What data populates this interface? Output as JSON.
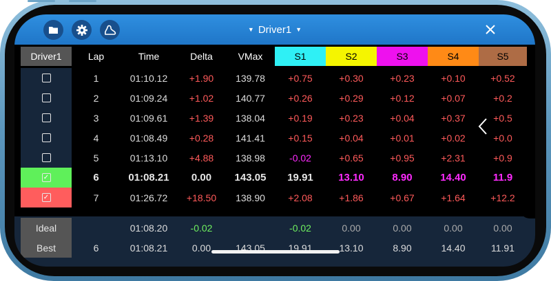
{
  "topbar": {
    "title": "Driver1",
    "left_icons": [
      "folder-icon",
      "gear-icon",
      "track-map-icon"
    ],
    "close_icon": "close-icon",
    "color": "#2a86d8"
  },
  "columns": [
    "Driver1",
    "Lap",
    "Time",
    "Delta",
    "VMax",
    "S1",
    "S2",
    "S3",
    "S4",
    "S5"
  ],
  "sector_colors": {
    "S1": "#2ff0f5",
    "S2": "#f5f500",
    "S3": "#ee11ee",
    "S4": "#ff8a16",
    "S5": "#ae6c45"
  },
  "laps": [
    {
      "checked": false,
      "lap": "1",
      "time": "01:10.12",
      "delta": "+1.90",
      "vmax": "139.78",
      "s1": "+0.75",
      "s2": "+0.30",
      "s3": "+0.23",
      "s4": "+0.10",
      "s5": "+0.52"
    },
    {
      "checked": false,
      "lap": "2",
      "time": "01:09.24",
      "delta": "+1.02",
      "vmax": "140.77",
      "s1": "+0.26",
      "s2": "+0.29",
      "s3": "+0.12",
      "s4": "+0.07",
      "s5": "+0.2"
    },
    {
      "checked": false,
      "lap": "3",
      "time": "01:09.61",
      "delta": "+1.39",
      "vmax": "138.04",
      "s1": "+0.19",
      "s2": "+0.23",
      "s3": "+0.04",
      "s4": "+0.37",
      "s5": "+0.5"
    },
    {
      "checked": false,
      "lap": "4",
      "time": "01:08.49",
      "delta": "+0.28",
      "vmax": "141.41",
      "s1": "+0.15",
      "s2": "+0.04",
      "s3": "+0.01",
      "s4": "+0.02",
      "s5": "+0.0"
    },
    {
      "checked": false,
      "lap": "5",
      "time": "01:13.10",
      "delta": "+4.88",
      "vmax": "138.98",
      "s1": "-0.02",
      "s2": "+0.65",
      "s3": "+0.95",
      "s4": "+2.31",
      "s5": "+0.9"
    },
    {
      "checked": true,
      "lap": "6",
      "time": "01:08.21",
      "delta": "0.00",
      "vmax": "143.05",
      "s1": "19.91",
      "s2": "13.10",
      "s3": "8.90",
      "s4": "14.40",
      "s5": "11.9"
    },
    {
      "checked": true,
      "lap": "7",
      "time": "01:26.72",
      "delta": "+18.50",
      "vmax": "138.90",
      "s1": "+2.08",
      "s2": "+1.86",
      "s3": "+0.67",
      "s4": "+1.64",
      "s5": "+12.2"
    }
  ],
  "ideal": {
    "label": "Ideal",
    "time": "01:08.20",
    "delta": "-0.02",
    "s1": "-0.02",
    "s2": "0.00",
    "s3": "0.00",
    "s4": "0.00",
    "s5": "0.00"
  },
  "best": {
    "label": "Best",
    "lap": "6",
    "time": "01:08.21",
    "delta": "0.00",
    "vmax": "143.05",
    "s1": "19.91",
    "s2": "13.10",
    "s3": "8.90",
    "s4": "14.40",
    "s5": "11.91"
  }
}
